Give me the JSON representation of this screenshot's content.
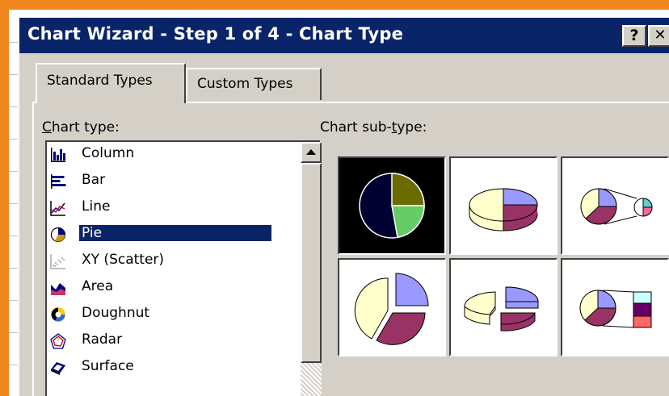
{
  "window": {
    "title": "Chart Wizard - Step 1 of 4 - Chart Type",
    "help_button": "?",
    "close_button": "✕"
  },
  "tabs": [
    {
      "label": "Standard Types",
      "active": true
    },
    {
      "label": "Custom Types",
      "active": false
    }
  ],
  "chart_type": {
    "label_first": "C",
    "label_rest": "hart type:",
    "items": [
      {
        "label": "Column",
        "icon": "column-chart-icon",
        "selected": false
      },
      {
        "label": "Bar",
        "icon": "bar-chart-icon",
        "selected": false
      },
      {
        "label": "Line",
        "icon": "line-chart-icon",
        "selected": false
      },
      {
        "label": "Pie",
        "icon": "pie-chart-icon",
        "selected": true
      },
      {
        "label": "XY (Scatter)",
        "icon": "scatter-chart-icon",
        "selected": false
      },
      {
        "label": "Area",
        "icon": "area-chart-icon",
        "selected": false
      },
      {
        "label": "Doughnut",
        "icon": "doughnut-chart-icon",
        "selected": false
      },
      {
        "label": "Radar",
        "icon": "radar-chart-icon",
        "selected": false
      },
      {
        "label": "Surface",
        "icon": "surface-chart-icon",
        "selected": false
      }
    ]
  },
  "sub_type": {
    "label_before": "Chart sub-",
    "label_underlined": "t",
    "label_after": "ype:",
    "items": [
      {
        "name": "pie",
        "selected": true
      },
      {
        "name": "3d-pie",
        "selected": false
      },
      {
        "name": "pie-of-pie",
        "selected": false
      },
      {
        "name": "exploded-pie",
        "selected": false
      },
      {
        "name": "exploded-3d-pie",
        "selected": false
      },
      {
        "name": "bar-of-pie",
        "selected": false
      }
    ]
  },
  "colors": {
    "titlebar": "#0a246a",
    "dialog": "#d4d0c8",
    "frame": "#f0871f",
    "pie_olive": "#6b6b00",
    "pie_green": "#66cc66",
    "pie_navy": "#000033",
    "pie_yellow": "#ffffcc",
    "pie_lavender": "#9999ff",
    "pie_plum": "#993366"
  }
}
